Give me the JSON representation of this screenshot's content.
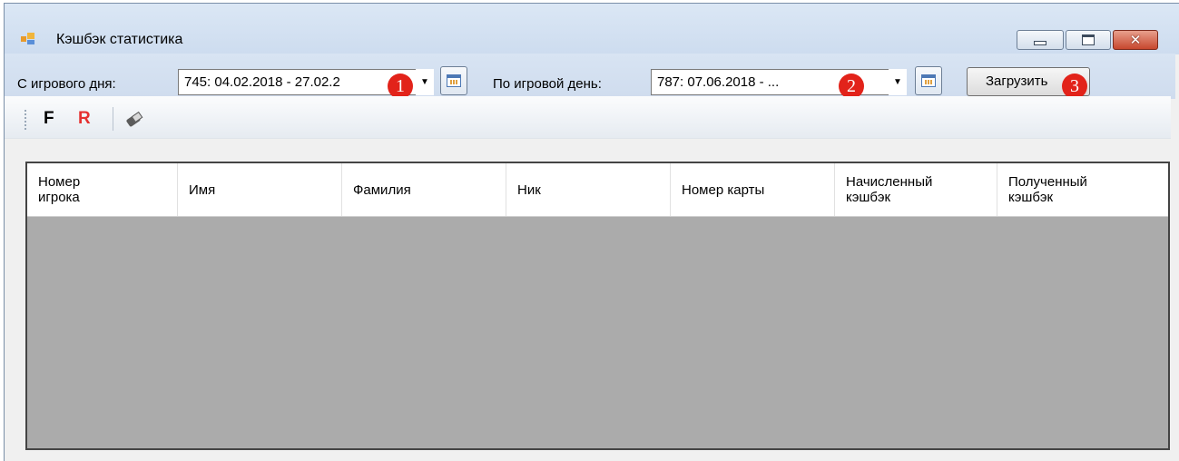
{
  "window": {
    "title": "Кэшбэк статистика",
    "controls": [
      "minimize",
      "maximize",
      "close"
    ]
  },
  "filters": {
    "from_label": "С игрового дня:",
    "from_value": "745: 04.02.2018 - 27.02.2",
    "to_label": "По игровой день:",
    "to_value": "787: 07.06.2018 - ...",
    "load_button": "Загрузить"
  },
  "badges": [
    "1",
    "2",
    "3"
  ],
  "toolstrip": {
    "f_label": "F",
    "r_label": "R",
    "icons": [
      "eraser-icon"
    ]
  },
  "grid": {
    "columns": [
      {
        "line1": "Номер",
        "line2": "игрока"
      },
      {
        "line1": "Имя",
        "line2": ""
      },
      {
        "line1": "Фамилия",
        "line2": ""
      },
      {
        "line1": "Ник",
        "line2": ""
      },
      {
        "line1": "Номер карты",
        "line2": ""
      },
      {
        "line1": "Начисленный",
        "line2": "кэшбэк"
      },
      {
        "line1": "Полученный",
        "line2": "кэшбэк"
      }
    ],
    "rows": []
  },
  "colors": {
    "badge": "#e2231a",
    "r_button": "#e53030",
    "grid_empty_bg": "#ababab",
    "titlebar": "#cddcef"
  }
}
